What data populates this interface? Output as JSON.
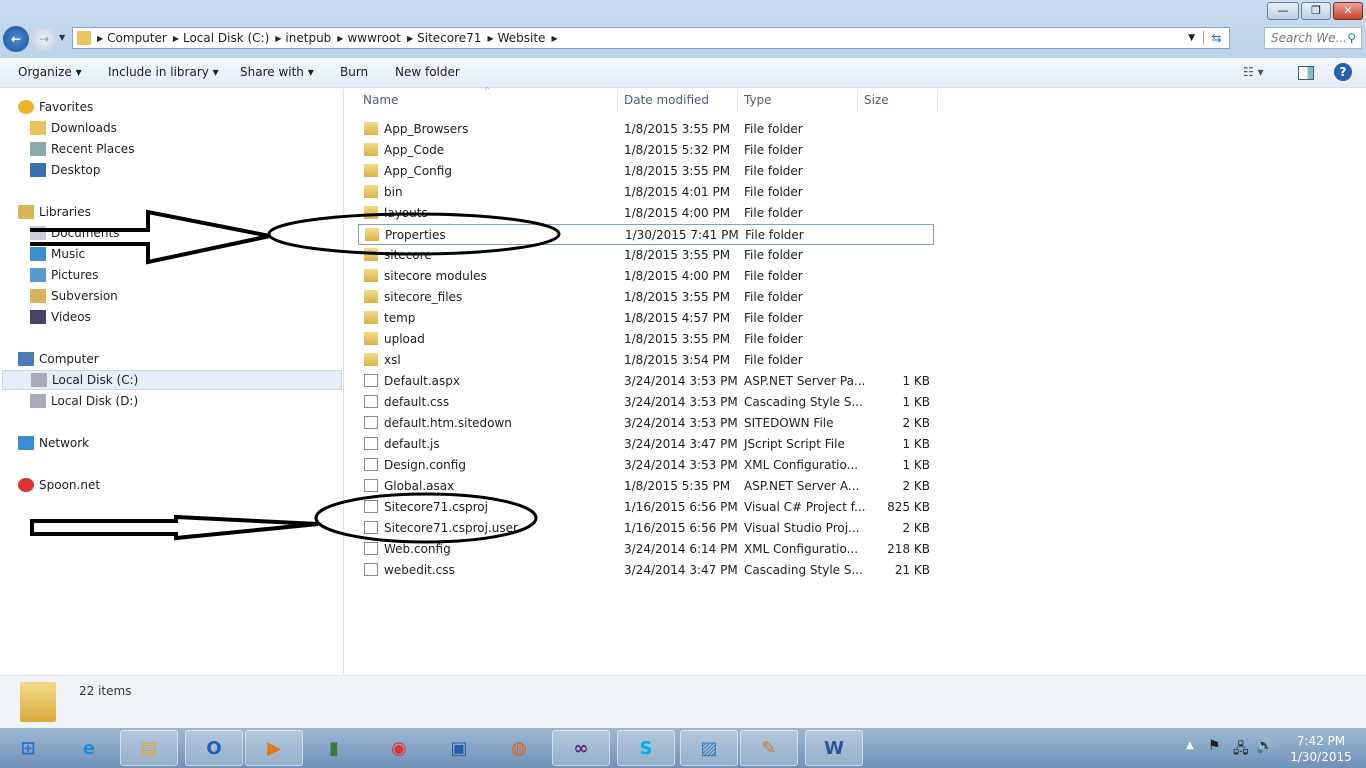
{
  "window": {
    "minimize": "—",
    "restore": "❐",
    "close": "✕"
  },
  "address": {
    "crumbs": [
      "Computer",
      "Local Disk (C:)",
      "inetpub",
      "wwwroot",
      "Sitecore71",
      "Website"
    ],
    "search_placeholder": "Search We..."
  },
  "toolbar": {
    "organize": "Organize ▾",
    "include": "Include in library ▾",
    "share": "Share with ▾",
    "burn": "Burn",
    "new_folder": "New folder"
  },
  "sidebar": {
    "items": [
      {
        "label": "Favorites",
        "icon": "star-icon",
        "level": 0
      },
      {
        "label": "Downloads",
        "icon": "folder-icon",
        "level": 1
      },
      {
        "label": "Recent Places",
        "icon": "recent-places-icon",
        "level": 1
      },
      {
        "label": "Desktop",
        "icon": "desktop-icon",
        "level": 1
      },
      {
        "label": "Libraries",
        "icon": "library-icon",
        "level": 0
      },
      {
        "label": "Documents",
        "icon": "document-icon",
        "level": 1
      },
      {
        "label": "Music",
        "icon": "music-icon",
        "level": 1
      },
      {
        "label": "Pictures",
        "icon": "pictures-icon",
        "level": 1
      },
      {
        "label": "Subversion",
        "icon": "library-icon",
        "level": 1
      },
      {
        "label": "Videos",
        "icon": "video-icon",
        "level": 1
      },
      {
        "label": "Computer",
        "icon": "computer-icon",
        "level": 0
      },
      {
        "label": "Local Disk (C:)",
        "icon": "drive-icon",
        "level": 1,
        "selected": true
      },
      {
        "label": "Local Disk (D:)",
        "icon": "drive-icon",
        "level": 1
      },
      {
        "label": "Network",
        "icon": "network-icon",
        "level": 0
      },
      {
        "label": "Spoon.net",
        "icon": "spoon-icon",
        "level": 0
      }
    ]
  },
  "columns": {
    "name": "Name",
    "date": "Date modified",
    "type": "Type",
    "size": "Size"
  },
  "files": [
    {
      "name": "App_Browsers",
      "date": "1/8/2015 3:55 PM",
      "type": "File folder",
      "size": "",
      "kind": "folder"
    },
    {
      "name": "App_Code",
      "date": "1/8/2015 5:32 PM",
      "type": "File folder",
      "size": "",
      "kind": "folder"
    },
    {
      "name": "App_Config",
      "date": "1/8/2015 3:55 PM",
      "type": "File folder",
      "size": "",
      "kind": "folder"
    },
    {
      "name": "bin",
      "date": "1/8/2015 4:01 PM",
      "type": "File folder",
      "size": "",
      "kind": "folder"
    },
    {
      "name": "layouts",
      "date": "1/8/2015 4:00 PM",
      "type": "File folder",
      "size": "",
      "kind": "folder"
    },
    {
      "name": "Properties",
      "date": "1/30/2015 7:41 PM",
      "type": "File folder",
      "size": "",
      "kind": "folder",
      "focused": true
    },
    {
      "name": "sitecore",
      "date": "1/8/2015 3:55 PM",
      "type": "File folder",
      "size": "",
      "kind": "folder"
    },
    {
      "name": "sitecore modules",
      "date": "1/8/2015 4:00 PM",
      "type": "File folder",
      "size": "",
      "kind": "folder"
    },
    {
      "name": "sitecore_files",
      "date": "1/8/2015 3:55 PM",
      "type": "File folder",
      "size": "",
      "kind": "folder"
    },
    {
      "name": "temp",
      "date": "1/8/2015 4:57 PM",
      "type": "File folder",
      "size": "",
      "kind": "folder"
    },
    {
      "name": "upload",
      "date": "1/8/2015 3:55 PM",
      "type": "File folder",
      "size": "",
      "kind": "folder"
    },
    {
      "name": "xsl",
      "date": "1/8/2015 3:54 PM",
      "type": "File folder",
      "size": "",
      "kind": "folder"
    },
    {
      "name": "Default.aspx",
      "date": "3/24/2014 3:53 PM",
      "type": "ASP.NET Server Pa...",
      "size": "1 KB",
      "kind": "file"
    },
    {
      "name": "default.css",
      "date": "3/24/2014 3:53 PM",
      "type": "Cascading Style S...",
      "size": "1 KB",
      "kind": "file"
    },
    {
      "name": "default.htm.sitedown",
      "date": "3/24/2014 3:53 PM",
      "type": "SITEDOWN File",
      "size": "2 KB",
      "kind": "file"
    },
    {
      "name": "default.js",
      "date": "3/24/2014 3:47 PM",
      "type": "JScript Script File",
      "size": "1 KB",
      "kind": "file"
    },
    {
      "name": "Design.config",
      "date": "3/24/2014 3:53 PM",
      "type": "XML Configuratio...",
      "size": "1 KB",
      "kind": "file"
    },
    {
      "name": "Global.asax",
      "date": "1/8/2015 5:35 PM",
      "type": "ASP.NET Server A...",
      "size": "2 KB",
      "kind": "file"
    },
    {
      "name": "Sitecore71.csproj",
      "date": "1/16/2015 6:56 PM",
      "type": "Visual C# Project f...",
      "size": "825 KB",
      "kind": "file"
    },
    {
      "name": "Sitecore71.csproj.user",
      "date": "1/16/2015 6:56 PM",
      "type": "Visual Studio Proj...",
      "size": "2 KB",
      "kind": "file"
    },
    {
      "name": "Web.config",
      "date": "3/24/2014 6:14 PM",
      "type": "XML Configuratio...",
      "size": "218 KB",
      "kind": "file"
    },
    {
      "name": "webedit.css",
      "date": "3/24/2014 3:47 PM",
      "type": "Cascading Style S...",
      "size": "21 KB",
      "kind": "file"
    }
  ],
  "status": {
    "count": "22 items"
  },
  "taskbar": {
    "apps": [
      {
        "name": "start",
        "glyph": "⊞",
        "color": "#2a74c8"
      },
      {
        "name": "internet-explorer",
        "glyph": "e",
        "color": "#1f8ee0"
      },
      {
        "name": "file-explorer",
        "glyph": "▤",
        "color": "#d9a93c",
        "open": true
      },
      {
        "name": "outlook",
        "glyph": "O",
        "color": "#1a64b4",
        "open": true
      },
      {
        "name": "media-player",
        "glyph": "▶",
        "color": "#e07a1a",
        "open": true
      },
      {
        "name": "app-installer",
        "glyph": "▮",
        "color": "#3a7a3a"
      },
      {
        "name": "chrome",
        "glyph": "◉",
        "color": "#d33"
      },
      {
        "name": "remote-desktop",
        "glyph": "▣",
        "color": "#2a5da8"
      },
      {
        "name": "firefox",
        "glyph": "◍",
        "color": "#e0631a"
      },
      {
        "name": "visual-studio",
        "glyph": "∞",
        "color": "#68217a",
        "open": true
      },
      {
        "name": "skype",
        "glyph": "S",
        "color": "#00aff0",
        "open": true
      },
      {
        "name": "photo-viewer",
        "glyph": "▨",
        "color": "#3a7fb8",
        "open": true
      },
      {
        "name": "paint",
        "glyph": "✎",
        "color": "#c08030",
        "open": true
      },
      {
        "name": "word",
        "glyph": "W",
        "color": "#2b5797",
        "open": true
      }
    ],
    "time": "7:42 PM",
    "date": "1/30/2015"
  }
}
